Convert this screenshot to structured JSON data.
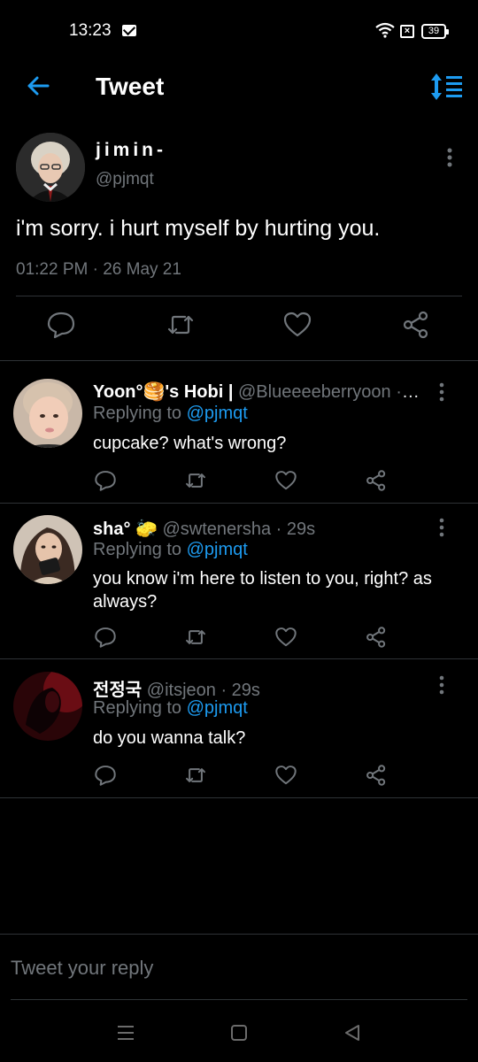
{
  "status_bar": {
    "time": "13:23",
    "battery": "39"
  },
  "header": {
    "title": "Tweet"
  },
  "main_tweet": {
    "name": "jimin-",
    "handle": "@pjmqt",
    "text": "i'm sorry. i hurt myself by hurting you.",
    "timestamp": "01:22 PM · 26 May 21"
  },
  "replies": [
    {
      "name": "Yoon°🥞's Hobi |",
      "handle": "@Blueeeeberryoon · ...",
      "replying_prefix": "Replying to ",
      "replying_to": "@pjmqt",
      "text": "cupcake? what's wrong?"
    },
    {
      "name": "sha° 🧽",
      "handle": "@swtenersha · 29s",
      "replying_prefix": "Replying to ",
      "replying_to": "@pjmqt",
      "text": "you know i'm here to listen to you, right? as always?"
    },
    {
      "name": "전정국",
      "handle": "@itsjeon · 29s",
      "replying_prefix": "Replying to ",
      "replying_to": "@pjmqt",
      "text": "do you wanna talk?"
    }
  ],
  "reply_bar": {
    "placeholder": "Tweet your reply"
  },
  "colors": {
    "accent": "#1d9bf0",
    "background": "#000000",
    "muted": "#71767b",
    "divider": "#2f3336"
  },
  "icons": {
    "status": [
      "mail-icon",
      "wifi-icon",
      "x-box-icon",
      "battery-icon"
    ],
    "header": [
      "back-arrow-icon",
      "sort-icon"
    ],
    "actions": [
      "reply-icon",
      "retweet-icon",
      "like-icon",
      "share-icon",
      "more-icon"
    ],
    "nav": [
      "menu-icon",
      "home-square-icon",
      "back-triangle-icon"
    ]
  }
}
